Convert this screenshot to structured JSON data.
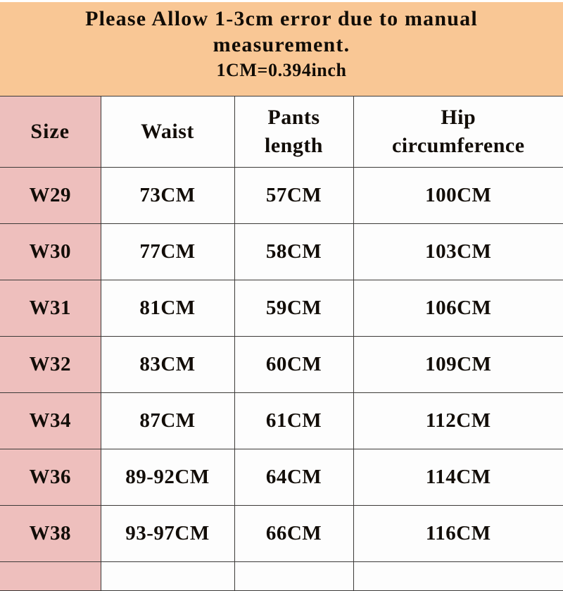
{
  "notice": {
    "line1": "Please Allow 1-3cm error due to manual",
    "line2": "measurement.",
    "line3": "1CM=0.394inch",
    "background_color": "#F9C795"
  },
  "table": {
    "header_size_bg": "#EDBFBD",
    "row_size_bg": "#EEBFBD",
    "cell_bg": "#FDFDFD",
    "border_color": "#3C3A38",
    "columns": [
      {
        "key": "size",
        "label": "Size"
      },
      {
        "key": "waist",
        "label": "Waist"
      },
      {
        "key": "pants_length",
        "label_line1": "Pants",
        "label_line2": "length"
      },
      {
        "key": "hip_circumference",
        "label_line1": "Hip",
        "label_line2": "circumference"
      }
    ],
    "rows": [
      {
        "size": "W29",
        "waist": "73CM",
        "pants_length": "57CM",
        "hip_circumference": "100CM"
      },
      {
        "size": "W30",
        "waist": "77CM",
        "pants_length": "58CM",
        "hip_circumference": "103CM"
      },
      {
        "size": "W31",
        "waist": "81CM",
        "pants_length": "59CM",
        "hip_circumference": "106CM"
      },
      {
        "size": "W32",
        "waist": "83CM",
        "pants_length": "60CM",
        "hip_circumference": "109CM"
      },
      {
        "size": "W34",
        "waist": "87CM",
        "pants_length": "61CM",
        "hip_circumference": "112CM"
      },
      {
        "size": "W36",
        "waist": "89-92CM",
        "pants_length": "64CM",
        "hip_circumference": "114CM"
      },
      {
        "size": "W38",
        "waist": "93-97CM",
        "pants_length": "66CM",
        "hip_circumference": "116CM"
      }
    ]
  }
}
